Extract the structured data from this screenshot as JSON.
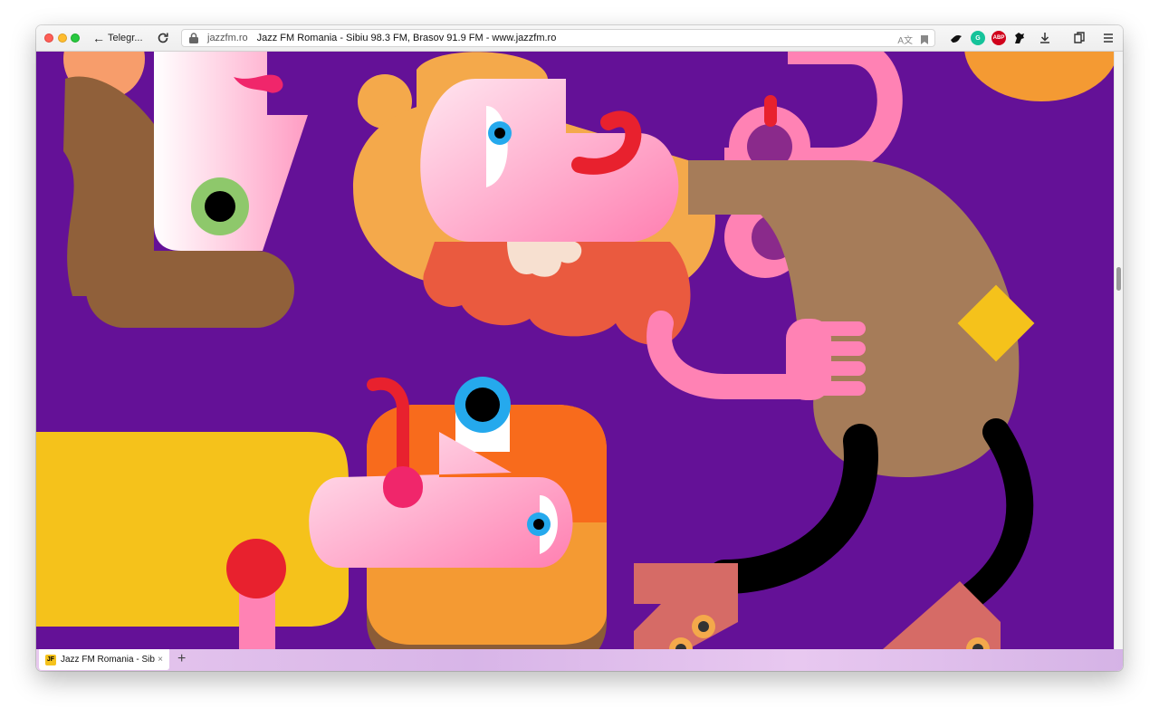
{
  "browser": {
    "back_label": "Telegr...",
    "url_domain": "jazzfm.ro",
    "page_title": "Jazz FM Romania - Sibiu 98.3 FM, Brasov 91.9 FM - www.jazzfm.ro",
    "translate_glyph": "A文",
    "extensions": [
      {
        "name": "grammarly",
        "color": "#15c39a",
        "label": "G"
      },
      {
        "name": "adblock-plus",
        "color": "#d0021b",
        "label": "ABP"
      }
    ]
  },
  "tabs": [
    {
      "title": "Jazz FM Romania - Sibiu",
      "favicon_text": "JF",
      "close": "×"
    }
  ],
  "new_tab_label": "+",
  "artwork": {
    "background_color": "#641197",
    "accent_colors": [
      "#f5c21b",
      "#ff7fb1",
      "#ea5a3f",
      "#f49a33",
      "#a67c59",
      "#e8212e"
    ]
  }
}
